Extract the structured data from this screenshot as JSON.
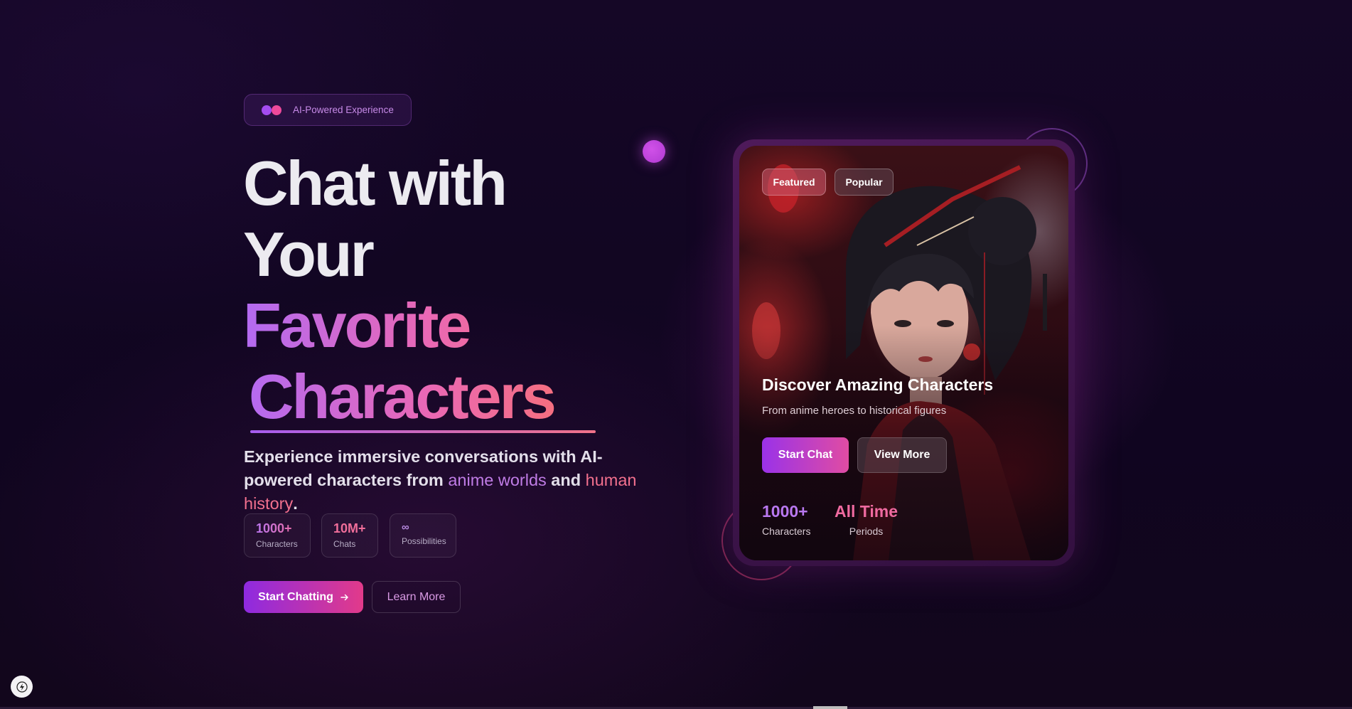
{
  "badge": {
    "text": "AI-Powered Experience",
    "dot_colors": [
      "#a44cf0",
      "#ee4a9a"
    ]
  },
  "hero": {
    "line1": "Chat with",
    "line2": "Your",
    "line3": "Favorite",
    "line4": "Characters",
    "subtitle_part1": "Experience immersive conversations with AI-powered characters from ",
    "subtitle_highlight1": "anime worlds",
    "subtitle_part2": " and ",
    "subtitle_highlight2": "human history",
    "subtitle_part3": "."
  },
  "stats": [
    {
      "value": "1000+",
      "label": "Characters"
    },
    {
      "value": "10M+",
      "label": "Chats"
    },
    {
      "value": "∞",
      "label": "Possibilities"
    }
  ],
  "actions": {
    "primary_label": "Start Chatting",
    "primary_icon": "arrow-right-icon",
    "secondary_label": "Learn More"
  },
  "card": {
    "chips": [
      "Featured",
      "Popular"
    ],
    "title": "Discover Amazing Characters",
    "subtitle": "From anime heroes to historical figures",
    "primary_label": "Start Chat",
    "secondary_label": "View More",
    "stats": [
      {
        "value": "1000+",
        "label": "Characters"
      },
      {
        "value": "All Time",
        "label": "Periods"
      }
    ]
  },
  "colors": {
    "background": "#11061e",
    "accent_purple": "#9a32e8",
    "accent_pink": "#e04ca3",
    "accent_coral": "#f56f80"
  },
  "corner_icon": "lightning-icon"
}
